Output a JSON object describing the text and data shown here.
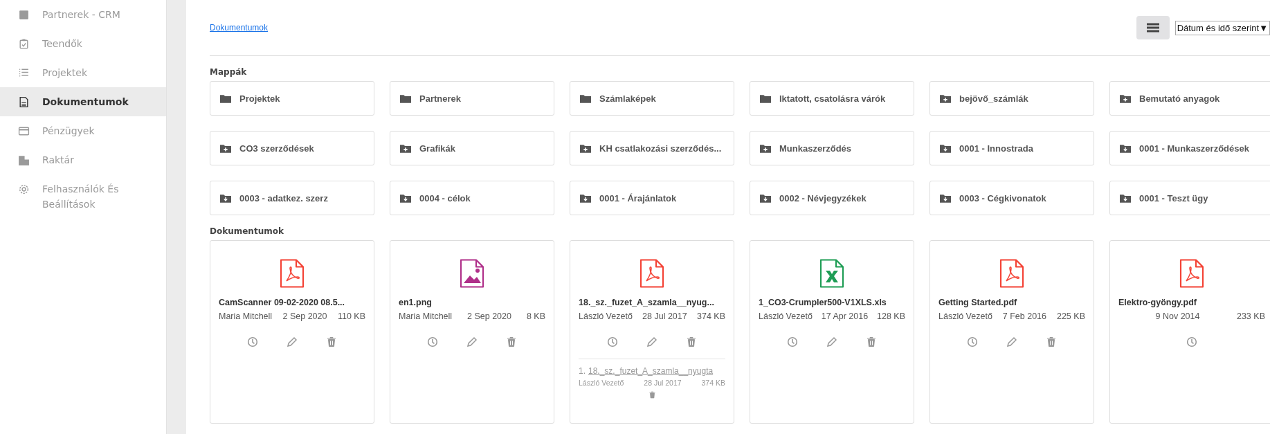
{
  "sidebar": {
    "items": [
      {
        "label": "Partnerek - CRM",
        "kind": "crm",
        "selected": false
      },
      {
        "label": "Teendők",
        "kind": "tasks",
        "selected": false
      },
      {
        "label": "Projektek",
        "kind": "list",
        "selected": false
      },
      {
        "label": "Dokumentumok",
        "kind": "document",
        "selected": true
      },
      {
        "label": "Pénzügyek",
        "kind": "card",
        "selected": false
      },
      {
        "label": "Raktár",
        "kind": "building",
        "selected": false
      },
      {
        "label": "Felhasználók És Beállítások",
        "kind": "gear",
        "selected": false
      }
    ]
  },
  "breadcrumb": "Dokumentumok",
  "sort_select": {
    "value": "Dátum és idő szerint▼"
  },
  "folders_heading": "Mappák",
  "folders": [
    {
      "name": "Projektek",
      "kind": "plain"
    },
    {
      "name": "Partnerek",
      "kind": "plain"
    },
    {
      "name": "Számlaképek",
      "kind": "plain"
    },
    {
      "name": "Iktatott, csatolásra várók",
      "kind": "plain"
    },
    {
      "name": "bejövő_számlák",
      "kind": "plus"
    },
    {
      "name": "Bemutató anyagok",
      "kind": "plus"
    },
    {
      "name": "CO3 szerződések",
      "kind": "plus"
    },
    {
      "name": "Grafikák",
      "kind": "plus"
    },
    {
      "name": "KH csatlakozási szerződés...",
      "kind": "plus"
    },
    {
      "name": "Munkaszerződés",
      "kind": "plus"
    },
    {
      "name": "0001 - Innostrada",
      "kind": "download"
    },
    {
      "name": "0001 - Munkaszerződések",
      "kind": "download"
    },
    {
      "name": "0003 - adatkez. szerz",
      "kind": "download"
    },
    {
      "name": "0004 - célok",
      "kind": "download"
    },
    {
      "name": "0001 - Árajánlatok",
      "kind": "download"
    },
    {
      "name": "0002 - Névjegyzékek",
      "kind": "download"
    },
    {
      "name": "0003 - Cégkivonatok",
      "kind": "download"
    },
    {
      "name": "0001 - Teszt ügy",
      "kind": "download"
    }
  ],
  "documents_heading": "Dokumentumok",
  "documents": [
    {
      "name": "CamScanner 09-02-2020 08.5...",
      "kind": "pdf",
      "owner": "Maria Mitchell",
      "date": "2 Sep 2020",
      "size": "110 KB",
      "actions": [
        {
          "kind": "history"
        },
        {
          "kind": "edit"
        },
        {
          "kind": "delete"
        }
      ]
    },
    {
      "name": "en1.png",
      "kind": "image",
      "owner": "Maria Mitchell",
      "date": "2 Sep 2020",
      "size": "8 KB",
      "actions": [
        {
          "kind": "history"
        },
        {
          "kind": "edit"
        },
        {
          "kind": "delete"
        }
      ]
    },
    {
      "name": "18._sz._fuzet_A_szamla__nyug...",
      "kind": "pdf",
      "owner": "László Vezető",
      "date": "28 Jul 2017",
      "size": "374 KB",
      "actions": [
        {
          "kind": "history"
        },
        {
          "kind": "edit"
        },
        {
          "kind": "delete"
        }
      ],
      "versions": [
        {
          "number": "1.",
          "name": "18._sz._fuzet_A_szamla__nyugta",
          "owner": "László Vezető",
          "date": "28 Jul 2017",
          "size": "374 KB"
        }
      ]
    },
    {
      "name": "1_CO3-Crumpler500-V1XLS.xls",
      "kind": "xls",
      "owner": "László Vezető",
      "date": "17 Apr 2016",
      "size": "128 KB",
      "actions": [
        {
          "kind": "history"
        },
        {
          "kind": "edit"
        },
        {
          "kind": "delete"
        }
      ]
    },
    {
      "name": "Getting Started.pdf",
      "kind": "pdf",
      "owner": "László Vezető",
      "date": "7 Feb 2016",
      "size": "225 KB",
      "actions": [
        {
          "kind": "history"
        },
        {
          "kind": "edit"
        },
        {
          "kind": "delete"
        }
      ]
    },
    {
      "name": "Elektro-gyöngy.pdf",
      "kind": "pdf",
      "date": "9 Nov 2014",
      "size": "233 KB",
      "actions": [
        {
          "kind": "history"
        }
      ]
    }
  ]
}
